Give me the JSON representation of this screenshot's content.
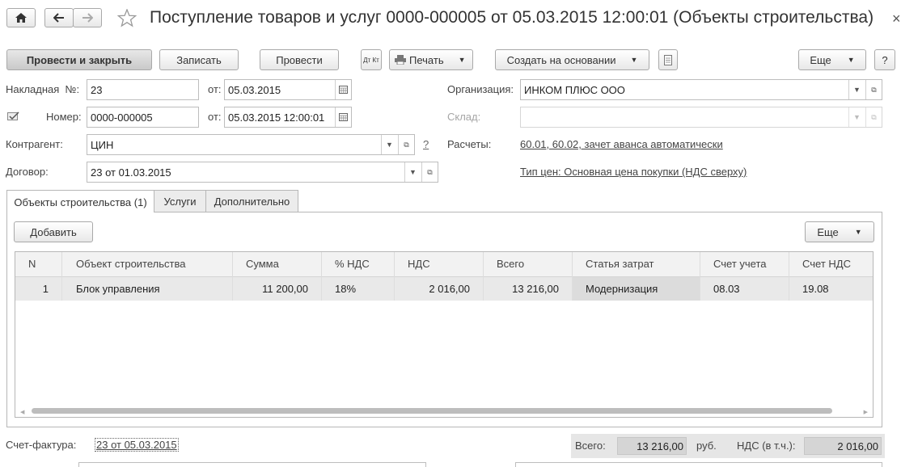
{
  "header": {
    "title": "Поступление товаров и услуг 0000-000005 от 05.03.2015 12:00:01 (Объекты строительства)",
    "close_glyph": "×"
  },
  "toolbar": {
    "post_and_close": "Провести и закрыть",
    "save": "Записать",
    "post": "Провести",
    "dt_kt": "Дт Кт",
    "print": "Печать",
    "create_based_on": "Создать на основании",
    "more": "Еще",
    "help": "?"
  },
  "form": {
    "invoice_label": "Накладная  №:",
    "invoice_number": "23",
    "invoice_date_label": "от:",
    "invoice_date": "05.03.2015",
    "number_label": "Номер:",
    "number": "0000-000005",
    "number_date_label": "от:",
    "number_date": "05.03.2015 12:00:01",
    "counterparty_label": "Контрагент:",
    "counterparty": "ЦИН",
    "contract_label": "Договор:",
    "contract": "23 от 01.03.2015",
    "organization_label": "Организация:",
    "organization": "ИНКОМ ПЛЮС ООО",
    "warehouse_label": "Склад:",
    "warehouse": "",
    "settlements_help": "?",
    "settlements_label": "Расчеты:",
    "settlements_link": "60.01, 60.02, зачет аванса автоматически",
    "price_type_link": "Тип цен: Основная цена покупки (НДС сверху)"
  },
  "tabs": [
    {
      "label": "Объекты строительства (1)",
      "active": true
    },
    {
      "label": "Услуги",
      "active": false
    },
    {
      "label": "Дополнительно",
      "active": false
    }
  ],
  "table_toolbar": {
    "add": "Добавить",
    "more": "Еще"
  },
  "table": {
    "columns": [
      "N",
      "Объект строительства",
      "Сумма",
      "% НДС",
      "НДС",
      "Всего",
      "Статья затрат",
      "Счет учета",
      "Счет НДС"
    ],
    "rows": [
      {
        "n": "1",
        "object": "Блок управления",
        "sum": "11 200,00",
        "vat_rate": "18%",
        "vat": "2 016,00",
        "total": "13 216,00",
        "cost_item": "Модернизация",
        "account": "08.03",
        "vat_account": "19.08"
      }
    ]
  },
  "footer": {
    "invoice_label": "Счет-фактура:",
    "invoice_link": "23 от 05.03.2015",
    "total_label": "Всего:",
    "total_value": "13 216,00",
    "currency": "руб.",
    "vat_label": "НДС (в т.ч.):",
    "vat_value": "2 016,00"
  }
}
